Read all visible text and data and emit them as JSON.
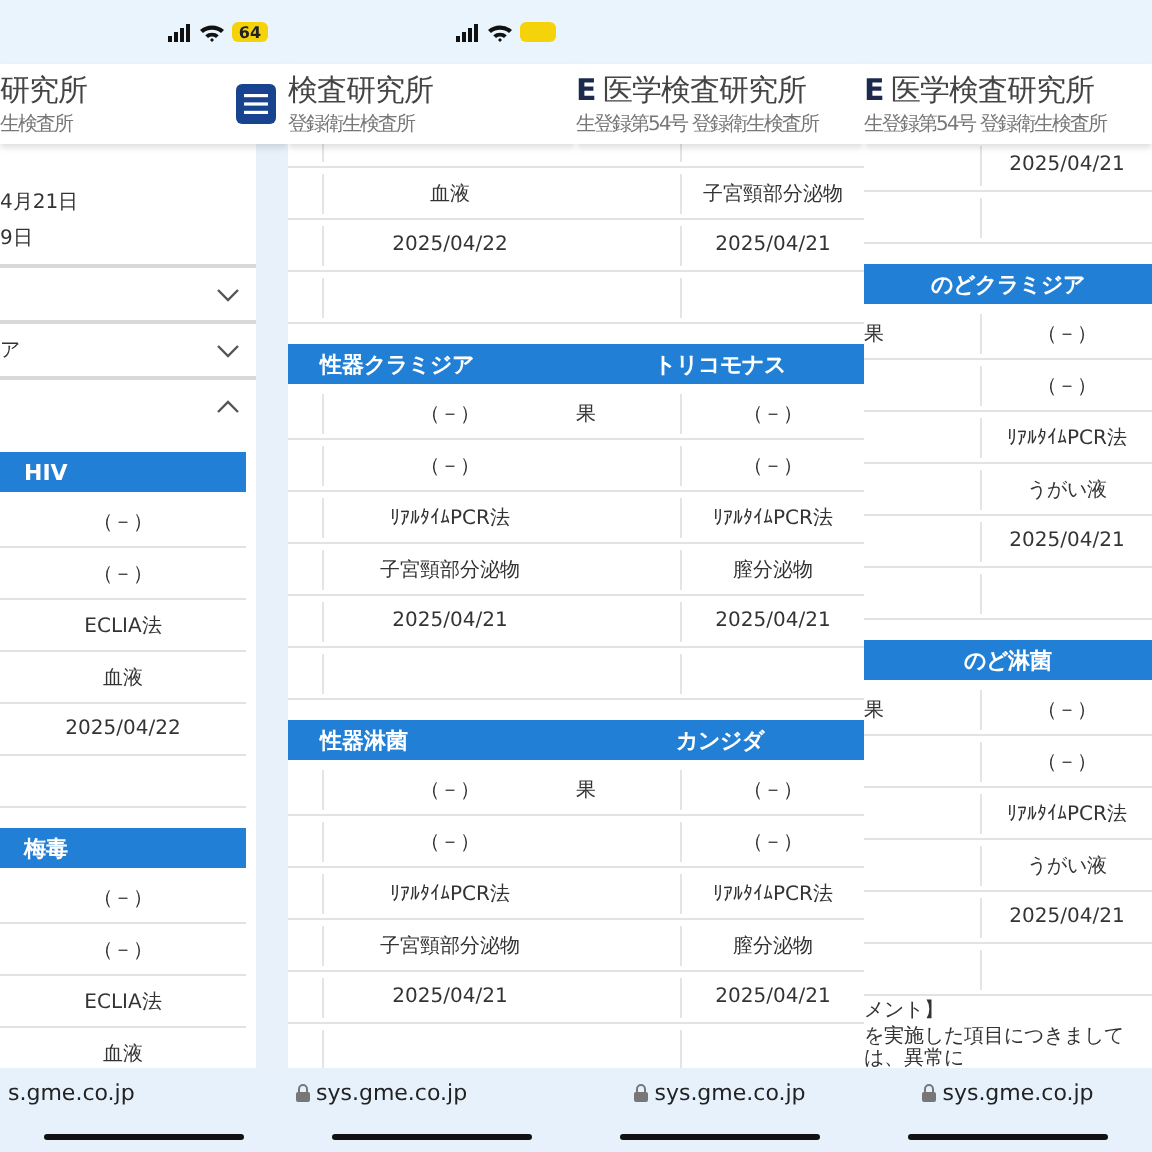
{
  "columns": [
    {
      "status": {
        "signal": true,
        "wifi": true,
        "battery": true,
        "battery_text": "64"
      },
      "header": {
        "logo": "研究所",
        "subtitle": "生検査所",
        "menu_button": true
      },
      "dates": [
        "4月21日",
        "9日"
      ],
      "accordions": [
        {
          "expanded": false
        },
        {
          "label": "ア",
          "expanded": false
        },
        {
          "expanded": true
        }
      ],
      "items": [
        {
          "kind": "section",
          "title": "HIV"
        },
        {
          "kind": "row",
          "value": "（－）"
        },
        {
          "kind": "row",
          "value": "（－）"
        },
        {
          "kind": "row",
          "value": "ECLIA法"
        },
        {
          "kind": "row",
          "value": "血液"
        },
        {
          "kind": "row",
          "value": "2025/04/22"
        },
        {
          "kind": "row"
        },
        {
          "kind": "section",
          "title": "梅毒"
        },
        {
          "kind": "row",
          "value": "（－）"
        },
        {
          "kind": "row",
          "value": "（－）"
        },
        {
          "kind": "row",
          "value": "ECLIA法"
        },
        {
          "kind": "row",
          "value": "血液"
        }
      ],
      "url": {
        "text": "s.gme.co.jp",
        "lock": false
      }
    },
    {
      "status": {
        "signal": true,
        "wifi": true,
        "battery": true
      },
      "header": {
        "logo": "検査研究所",
        "subtitle": "登録衛生検査所",
        "menu_button": false
      },
      "items": [
        {
          "kind": "row"
        },
        {
          "kind": "row",
          "value": "血液"
        },
        {
          "kind": "row",
          "value": "2025/04/22"
        },
        {
          "kind": "row"
        },
        {
          "kind": "section",
          "title": "性器クラミジア"
        },
        {
          "kind": "row",
          "value": "（－）"
        },
        {
          "kind": "row",
          "value": "（－）"
        },
        {
          "kind": "row",
          "value": "ﾘｱﾙﾀｲﾑPCR法"
        },
        {
          "kind": "row",
          "value": "子宮頸部分泌物"
        },
        {
          "kind": "row",
          "value": "2025/04/21"
        },
        {
          "kind": "row"
        },
        {
          "kind": "section",
          "title": "性器淋菌"
        },
        {
          "kind": "row",
          "value": "（－）"
        },
        {
          "kind": "row",
          "value": "（－）"
        },
        {
          "kind": "row",
          "value": "ﾘｱﾙﾀｲﾑPCR法"
        },
        {
          "kind": "row",
          "value": "子宮頸部分泌物"
        },
        {
          "kind": "row",
          "value": "2025/04/21"
        },
        {
          "kind": "row"
        }
      ],
      "url": {
        "text": "sys.gme.co.jp",
        "lock": true
      }
    },
    {
      "header": {
        "mark": "E",
        "logo": "医学検査研究所",
        "subtitle": "生登録第54号 登録衛生検査所",
        "menu_button": false
      },
      "items": [
        {
          "kind": "row"
        },
        {
          "kind": "row",
          "value": "子宮頸部分泌物"
        },
        {
          "kind": "row",
          "value": "2025/04/21"
        },
        {
          "kind": "row"
        },
        {
          "kind": "section",
          "title": "トリコモナス"
        },
        {
          "kind": "row",
          "label": "果",
          "value": "（－）"
        },
        {
          "kind": "row",
          "value": "（－）"
        },
        {
          "kind": "row",
          "value": "ﾘｱﾙﾀｲﾑPCR法"
        },
        {
          "kind": "row",
          "value": "膣分泌物"
        },
        {
          "kind": "row",
          "value": "2025/04/21"
        },
        {
          "kind": "row"
        },
        {
          "kind": "section",
          "title": "カンジダ"
        },
        {
          "kind": "row",
          "label": "果",
          "value": "（－）"
        },
        {
          "kind": "row",
          "value": "（－）"
        },
        {
          "kind": "row",
          "value": "ﾘｱﾙﾀｲﾑPCR法"
        },
        {
          "kind": "row",
          "value": "膣分泌物"
        },
        {
          "kind": "row",
          "value": "2025/04/21"
        },
        {
          "kind": "row"
        }
      ],
      "url": {
        "text": "sys.gme.co.jp",
        "lock": true
      }
    },
    {
      "header": {
        "mark": "E",
        "logo": "医学検査研究所",
        "subtitle": "生登録第54号 登録衛生検査所",
        "menu_button": false
      },
      "items": [
        {
          "kind": "row",
          "value": "2025/04/21"
        },
        {
          "kind": "row"
        },
        {
          "kind": "section",
          "title": "のどクラミジア"
        },
        {
          "kind": "row",
          "label": "果",
          "value": "（－）"
        },
        {
          "kind": "row",
          "value": "（－）"
        },
        {
          "kind": "row",
          "value": "ﾘｱﾙﾀｲﾑPCR法"
        },
        {
          "kind": "row",
          "value": "うがい液"
        },
        {
          "kind": "row",
          "value": "2025/04/21"
        },
        {
          "kind": "row"
        },
        {
          "kind": "section",
          "title": "のど淋菌"
        },
        {
          "kind": "row",
          "label": "果",
          "value": "（－）"
        },
        {
          "kind": "row",
          "value": "（－）"
        },
        {
          "kind": "row",
          "value": "ﾘｱﾙﾀｲﾑPCR法"
        },
        {
          "kind": "row",
          "value": "うがい液"
        },
        {
          "kind": "row",
          "value": "2025/04/21"
        },
        {
          "kind": "row"
        },
        {
          "kind": "comment",
          "lines": [
            "メント】",
            "を実施した項目につきましては、異常に"
          ]
        }
      ],
      "url": {
        "text": "sys.gme.co.jp",
        "lock": true
      }
    }
  ]
}
